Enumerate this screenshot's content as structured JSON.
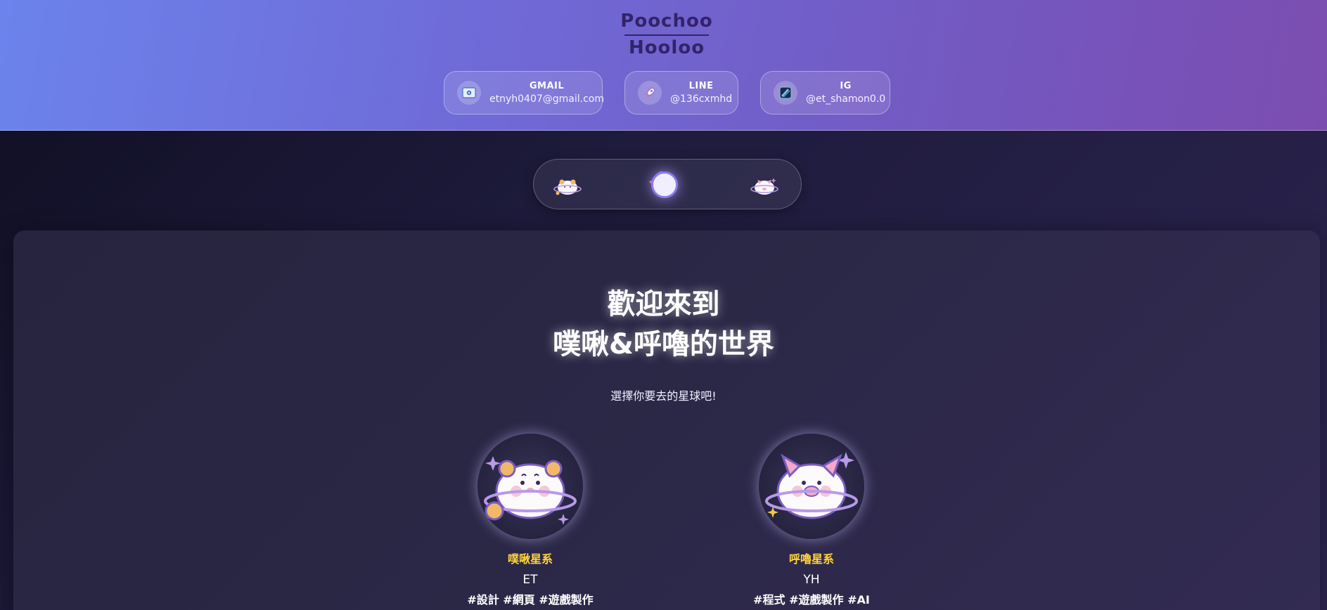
{
  "header": {
    "logo_line1": "Poochoo",
    "logo_line2": "Hooloo",
    "contacts": [
      {
        "label": "GMAIL",
        "value": "etnyh0407@gmail.com",
        "icon": "mail-icon"
      },
      {
        "label": "LINE",
        "value": "@136cxmhd",
        "icon": "rocket-icon"
      },
      {
        "label": "IG",
        "value": "@et_shamon0.0",
        "icon": "instagram-icon"
      }
    ]
  },
  "selector": {
    "items": [
      {
        "icon": "hamster-planet-icon"
      },
      {
        "icon": "rocket-icon",
        "active": true
      },
      {
        "icon": "pig-planet-icon"
      }
    ]
  },
  "main": {
    "title_line1": "歡迎來到",
    "title_line2": "噗啾&呼嚕的世界",
    "subtitle": "選擇你要去的星球吧!",
    "planets": [
      {
        "name": "噗啾星系",
        "owner": "ET",
        "tags": "#設計 #網頁 #遊戲製作",
        "icon": "hamster-planet-icon"
      },
      {
        "name": "呼嚕星系",
        "owner": "YH",
        "tags": "#程式 #遊戲製作 #AI",
        "icon": "pig-planet-icon"
      }
    ]
  },
  "colors": {
    "header_start": "#6c83ec",
    "header_end": "#7c4db0",
    "accent_yellow": "#ffd43b",
    "background": "#1e1b3c"
  }
}
